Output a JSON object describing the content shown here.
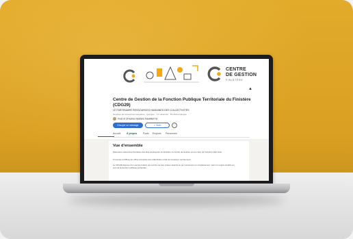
{
  "banner": {
    "org_line1": "CENTRE",
    "org_line2": "DE GESTION",
    "org_line3": "FINISTÈRE"
  },
  "profile": {
    "title": "Centre de Gestion de la Fonction Publique Territoriale du Finistère (CDG29)",
    "subtitle": "LE PARTENAIRE RESSOURCES HUMAINES DES COLLECTIVITÉS",
    "meta": "Services de ressources humaines · Quimper · 2 K abonnés · 51-200 employés",
    "relations": "Vous et 29 autres relations travaillent ici",
    "message_label": "Envoyer un message",
    "follow_label": "✓ Suivi",
    "more_label": "···"
  },
  "tabs": [
    "Accueil",
    "À propos",
    "Posts",
    "Emplois",
    "Personnes"
  ],
  "about": {
    "heading": "Vue d'ensemble",
    "p1": "Partenaire ressources humaines des élus employeurs du Finistère, le Centre de Gestion est au cœur de l'emploi public local.",
    "p2": "Il recense et diffuse les offres d'emplois des collectivités et fait du conseil en recrutement.",
    "p3": "Le CDG29 dispose d'un service Intérim qui recrute sur des postes vacants ou qui concernent un remplacement, sans un emploi durable au sein de la fonction publique territoriale."
  },
  "colors": {
    "wall": "#e0a82a",
    "primary_button": "#2f6fcf",
    "active_tab": "#1f6b4a",
    "logo_orange": "#f0a81c"
  }
}
